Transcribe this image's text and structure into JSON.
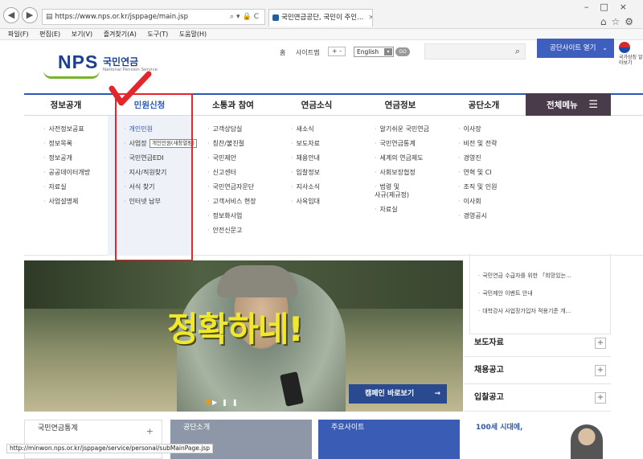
{
  "browser": {
    "url": "https://www.nps.or.kr/jsppage/main.jsp",
    "tabs": [
      "국민연금공단, 국민이 주인..."
    ],
    "menubar": [
      "파일(F)",
      "편집(E)",
      "보기(V)",
      "즐겨찾기(A)",
      "도구(T)",
      "도움말(H)"
    ],
    "status_url": "http://minwon.nps.or.kr/jsppage/service/personal/subMainPage.jsp"
  },
  "header": {
    "logo_text": "NPS",
    "logo_kr": "국민연금",
    "logo_en": "National Pension Service",
    "util_links": [
      "홈",
      "사이트맵"
    ],
    "zoom_label": "+ -",
    "language": "English",
    "go_label": "GO",
    "site_open_label": "공단사이트 열기",
    "flag_text": "국가상징 알아보기"
  },
  "gnb": {
    "items": [
      "정보공개",
      "민원신청",
      "소통과 참여",
      "연금소식",
      "연금정보",
      "공단소개"
    ],
    "all_menu": "전체메뉴"
  },
  "submenu": {
    "col0": [
      "사전정보공표",
      "정보목록",
      "정보공개",
      "공공데이터개방",
      "자료실",
      "사업설명제"
    ],
    "col1": [
      "개인민원",
      "사업장",
      "국민연금EDI",
      "지사/직원찾기",
      "서식 찾기",
      "인터넷 납부"
    ],
    "col2": [
      "고객상담실",
      "칭찬/불친절",
      "국민제안",
      "신고센터",
      "국민연금자문단",
      "고객서비스 현장",
      "정보화사업",
      "안전신문고"
    ],
    "col3": [
      "새소식",
      "보도자료",
      "채용안내",
      "입찰정보",
      "지사소식",
      "사옥임대"
    ],
    "col4": [
      "알기쉬운 국민연금",
      "국민연금통계",
      "세계의 연금제도",
      "사회보장협정",
      "법령 및\n사규(제규정)",
      "자료실"
    ],
    "col5": [
      "이사장",
      "비전 및 전략",
      "경영진",
      "연혁 및 CI",
      "조직 및 인원",
      "이사회",
      "경영공시"
    ],
    "tooltip": "개인민원(새창열림)"
  },
  "banner": {
    "headline": "정확하네!",
    "campaign_label": "캠페인 바로보기"
  },
  "news": [
    "국민연금 수급자를 위한 「희망있는...",
    "국민제안 이벤트 안내",
    "대학강사 사업장가입자 적용기준 개..."
  ],
  "accordion": [
    "보도자료",
    "채용공고",
    "입찰공고"
  ],
  "bottom": {
    "stats": "국민연금통계",
    "about": "공단소개",
    "sites": "주요사이트",
    "age100": "100세 시대에,"
  }
}
